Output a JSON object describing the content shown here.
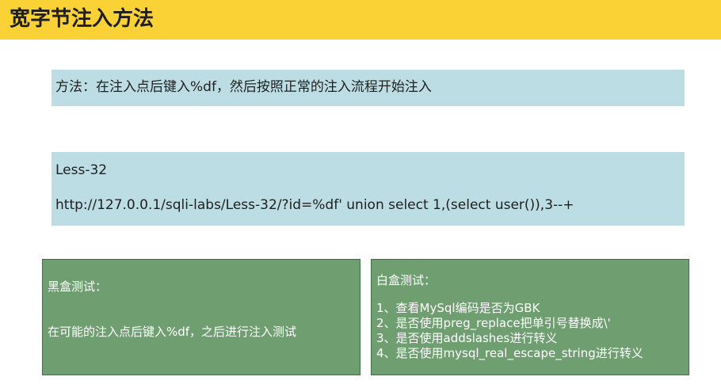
{
  "title": "宽字节注入方法",
  "method": "方法：在注入点后键入%df，然后按照正常的注入流程开始注入",
  "less": {
    "title": "Less-32",
    "url": "http://127.0.0.1/sqli-labs/Less-32/?id=%df' union select 1,(select user()),3--+"
  },
  "black_box": {
    "title": "黑盒测试：",
    "desc": "在可能的注入点后键入%df，之后进行注入测试"
  },
  "white_box": {
    "title": "白盒测试：",
    "items": [
      "1、查看MySql编码是否为GBK",
      "2、是否使用preg_replace把单引号替换成\\'",
      "3、是否使用addslashes进行转义",
      "4、是否使用mysql_real_escape_string进行转义"
    ]
  },
  "colors": {
    "title_bar": "#fbd235",
    "blue_box": "#bcdde3",
    "green_box": "#6f9f71"
  }
}
